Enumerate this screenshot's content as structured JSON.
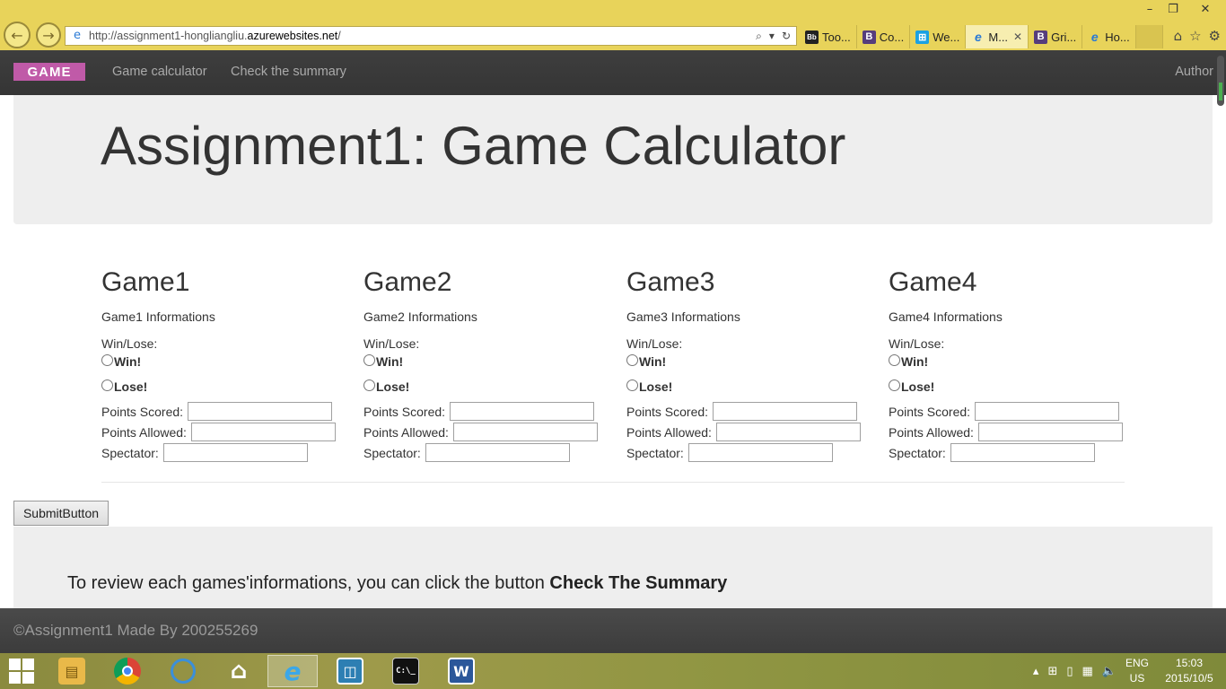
{
  "browser": {
    "url_prefix": "http://assignment1-hongliangliu.",
    "url_host": "azurewebsites.net",
    "url_suffix": "/",
    "tabs": [
      {
        "label": "Too...",
        "icon": "Bb",
        "color": "#222"
      },
      {
        "label": "Co...",
        "icon": "B",
        "color": "#563d7c"
      },
      {
        "label": "We...",
        "icon": "win",
        "color": "#1ba1e2"
      },
      {
        "label": "M...",
        "icon": "ie",
        "color": "#2a7ad5",
        "active": true
      },
      {
        "label": "Gri...",
        "icon": "B",
        "color": "#563d7c"
      },
      {
        "label": "Ho...",
        "icon": "ie",
        "color": "#2a7ad5"
      }
    ],
    "window_controls": {
      "minimize": "–",
      "restore": "❐",
      "close": "✕"
    }
  },
  "navbar": {
    "brand": "GAME",
    "links": [
      "Game calculator",
      "Check the summary"
    ],
    "author": "Author"
  },
  "jumbotron": {
    "title": "Assignment1: Game Calculator"
  },
  "games": [
    {
      "title": "Game1",
      "info": "Game1 Informations"
    },
    {
      "title": "Game2",
      "info": "Game2 Informations"
    },
    {
      "title": "Game3",
      "info": "Game3 Informations"
    },
    {
      "title": "Game4",
      "info": "Game4 Informations"
    }
  ],
  "form_labels": {
    "win_lose": "Win/Lose:",
    "win": "Win!",
    "lose": "Lose!",
    "points_scored": "Points Scored:",
    "points_allowed": "Points Allowed:",
    "spectator": "Spectator:"
  },
  "submit_label": "SubmitButton",
  "review": {
    "text": "To review each games'informations, you can click the button ",
    "bold": "Check The Summary"
  },
  "footer": {
    "text": "©Assignment1 Made By 200255269"
  },
  "taskbar": {
    "language_top": "ENG",
    "language_bottom": "US",
    "time": "15:03",
    "date": "2015/10/5",
    "apps": [
      "file-explorer",
      "chrome",
      "onedrive",
      "home",
      "internet-explorer",
      "app-square",
      "cmd",
      "word-app"
    ]
  }
}
